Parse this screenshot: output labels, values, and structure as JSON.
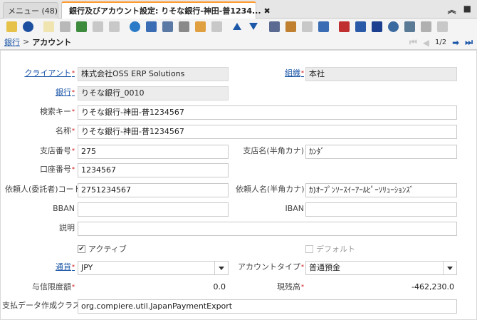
{
  "tabs": {
    "menu_label": "メニュー (48)",
    "active_label": "銀行及びアカウント設定: りそな銀行-神田-普1234...",
    "close_glyph": "✖"
  },
  "window_controls": {
    "collapse_glyph": "︽",
    "maximize_glyph": "■"
  },
  "toolbar": {
    "icons": [
      {
        "name": "ignore-icon",
        "color": "#e6c24a"
      },
      {
        "name": "help-icon",
        "color": "#1d4fa0"
      },
      {
        "name": "new-record-icon",
        "color": "#f0e4b0"
      },
      {
        "name": "copy-record-icon",
        "color": "#b8b8b8"
      },
      {
        "name": "delete-record-icon",
        "color": "#3d8b3d"
      },
      {
        "name": "save-icon",
        "color": "#c8c8c8"
      },
      {
        "name": "save-new-icon",
        "color": "#c8c8c8"
      },
      {
        "name": "refresh-icon",
        "color": "#2a7ac8"
      },
      {
        "name": "find-icon",
        "color": "#3b6db5"
      },
      {
        "name": "attachment-icon",
        "color": "#5a7aa5"
      },
      {
        "name": "chat-icon",
        "color": "#8a8a8a"
      },
      {
        "name": "grid-toggle-icon",
        "color": "#e0a040"
      },
      {
        "name": "multi-window-icon",
        "color": "#c8c8c8"
      },
      {
        "name": "previous-record-icon",
        "color": "#1d57a8"
      },
      {
        "name": "next-record-icon",
        "color": "#1d57a8"
      },
      {
        "name": "report-icon",
        "color": "#5a6a90"
      },
      {
        "name": "archive-icon",
        "color": "#c08030"
      },
      {
        "name": "print-icon",
        "color": "#c8c8c8"
      },
      {
        "name": "zoom-across-icon",
        "color": "#3b6db5"
      },
      {
        "name": "workflow-icon",
        "color": "#c03030"
      },
      {
        "name": "product-info-icon",
        "color": "#2a5aa8"
      },
      {
        "name": "process-icon",
        "color": "#1d3f90"
      },
      {
        "name": "settings-icon",
        "color": "#3a6aa0"
      },
      {
        "name": "export-icon",
        "color": "#5a7a95"
      },
      {
        "name": "import-icon",
        "color": "#b0b0b0"
      },
      {
        "name": "customize-icon",
        "color": "#c8c8c8"
      }
    ]
  },
  "breadcrumb": {
    "parent": "銀行",
    "separator": ">",
    "current": "アカウント"
  },
  "navigator": {
    "first": "⏮",
    "prev": "◀",
    "position": "1/2",
    "next": "➡",
    "last": "⏭"
  },
  "form": {
    "client": {
      "label": "クライアント",
      "value": "株式会社OSS ERP Solutions"
    },
    "org": {
      "label": "組織",
      "value": "本社"
    },
    "bank": {
      "label": "銀行",
      "value": "りそな銀行_0010"
    },
    "search_key": {
      "label": "検索キー",
      "value": "りそな銀行-神田-普1234567"
    },
    "name": {
      "label": "名称",
      "value": "りそな銀行-神田-普1234567"
    },
    "branch_no": {
      "label": "支店番号",
      "value": "275"
    },
    "branch_name_kana": {
      "label": "支店名(半角カナ)",
      "value": "ｶﾝﾀﾞ"
    },
    "account_no": {
      "label": "口座番号",
      "value": "1234567"
    },
    "requester_code": {
      "label": "依頼人(委託者)コード",
      "value": "2751234567"
    },
    "requester_name_kana": {
      "label": "依頼人名(半角カナ)",
      "value": "ｶ)ｵｰﾌﾟﾝｿｰｽｲｰｱｰﾙﾋﾟｰｿﾘｭｰｼｮﾝｽﾞ"
    },
    "bban": {
      "label": "BBAN",
      "value": ""
    },
    "iban": {
      "label": "IBAN",
      "value": ""
    },
    "description": {
      "label": "説明",
      "value": ""
    },
    "active": {
      "label": "アクティブ",
      "checked": true,
      "check_glyph": "✔"
    },
    "default": {
      "label": "デフォルト",
      "checked": false
    },
    "currency": {
      "label": "通貨",
      "value": "JPY"
    },
    "account_type": {
      "label": "アカウントタイプ",
      "value": "普通預金"
    },
    "credit_limit": {
      "label": "与信限度額",
      "value": "0.0"
    },
    "current_balance": {
      "label": "現残高",
      "value": "-462,230.0"
    },
    "payment_export_class": {
      "label": "支払データ作成クラス",
      "value": "org.compiere.util.JapanPaymentExport"
    }
  },
  "required_mark": "*"
}
